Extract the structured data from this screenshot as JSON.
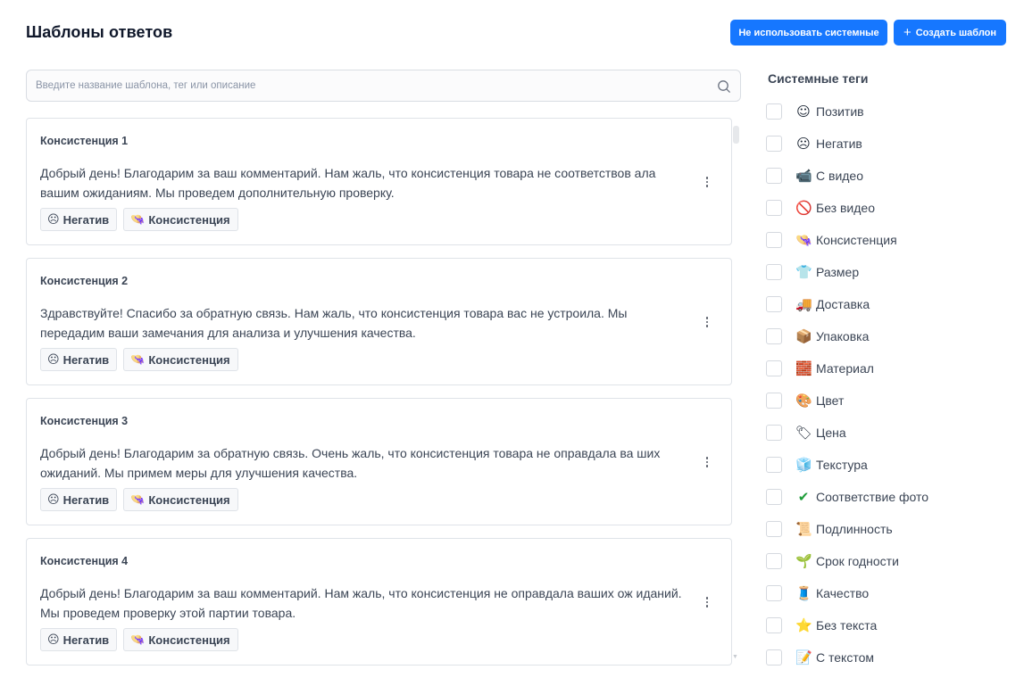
{
  "header": {
    "title": "Шаблоны ответов",
    "btn_system": "Не использовать системные",
    "btn_create": "Создать шаблон"
  },
  "search": {
    "placeholder": "Введите название шаблона, тег или описание",
    "value": ""
  },
  "templates": [
    {
      "title": "Консистенция 1",
      "text": "Добрый день! Благодарим за ваш комментарий. Нам жаль, что консистенция товара не соответствов ала вашим ожиданиям. Мы проведем дополнительную проверку.",
      "tags": [
        {
          "emoji": "☹",
          "label": "Негатив"
        },
        {
          "emoji": "👒",
          "label": "Консистенция"
        }
      ]
    },
    {
      "title": "Консистенция 2",
      "text": "Здравствуйте! Спасибо за обратную связь. Нам жаль, что консистенция товара вас не устроила. Мы передадим ваши замечания для анализа и улучшения качества.",
      "tags": [
        {
          "emoji": "☹",
          "label": "Негатив"
        },
        {
          "emoji": "👒",
          "label": "Консистенция"
        }
      ]
    },
    {
      "title": "Консистенция 3",
      "text": "Добрый день! Благодарим за обратную связь. Очень жаль, что консистенция товара не оправдала ва ших ожиданий. Мы примем меры для улучшения качества.",
      "tags": [
        {
          "emoji": "☹",
          "label": "Негатив"
        },
        {
          "emoji": "👒",
          "label": "Консистенция"
        }
      ]
    },
    {
      "title": "Консистенция 4",
      "text": "Добрый день! Благодарим за ваш комментарий. Нам жаль, что консистенция не оправдала ваших ож иданий. Мы проведем проверку этой партии товара.",
      "tags": [
        {
          "emoji": "☹",
          "label": "Негатив"
        },
        {
          "emoji": "👒",
          "label": "Консистенция"
        }
      ]
    }
  ],
  "system_tags": {
    "title": "Системные теги",
    "items": [
      {
        "emoji": "☺",
        "label": "Позитив",
        "checked": false
      },
      {
        "emoji": "☹",
        "label": "Негатив",
        "checked": false
      },
      {
        "emoji": "📹",
        "label": "С видео",
        "checked": false
      },
      {
        "emoji": "🚫",
        "label": "Без видео",
        "checked": false
      },
      {
        "emoji": "👒",
        "label": "Консистенция",
        "checked": false
      },
      {
        "emoji": "👕",
        "label": "Размер",
        "checked": false
      },
      {
        "emoji": "🚚",
        "label": "Доставка",
        "checked": false
      },
      {
        "emoji": "📦",
        "label": "Упаковка",
        "checked": false
      },
      {
        "emoji": "🧱",
        "label": "Материал",
        "checked": false
      },
      {
        "emoji": "🎨",
        "label": "Цвет",
        "checked": false
      },
      {
        "emoji": "🏷",
        "label": "Цена",
        "checked": false
      },
      {
        "emoji": "🧊",
        "label": "Текстура",
        "checked": false
      },
      {
        "emoji": "✔",
        "label": "Соответствие фото",
        "checked": false
      },
      {
        "emoji": "📜",
        "label": "Подлинность",
        "checked": false
      },
      {
        "emoji": "🌱",
        "label": "Срок годности",
        "checked": false
      },
      {
        "emoji": "🧵",
        "label": "Качество",
        "checked": false
      },
      {
        "emoji": "⭐",
        "label": "Без текста",
        "checked": false
      },
      {
        "emoji": "📝",
        "label": "С текстом",
        "checked": false
      }
    ]
  },
  "colors": {
    "accent": "#1677ff",
    "text": "#3b4555",
    "border": "#dfe3e8"
  }
}
